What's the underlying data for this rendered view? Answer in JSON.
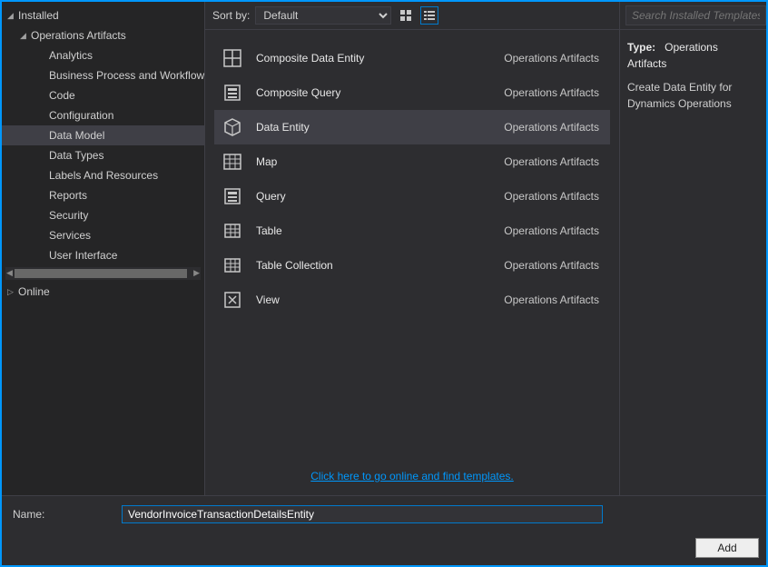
{
  "sidebar": {
    "root": "Installed",
    "group": "Operations Artifacts",
    "items": [
      "Analytics",
      "Business Process and Workflow",
      "Code",
      "Configuration",
      "Data Model",
      "Data Types",
      "Labels And Resources",
      "Reports",
      "Security",
      "Services",
      "User Interface"
    ],
    "selected_index": 4,
    "online": "Online"
  },
  "sortbar": {
    "label": "Sort by:",
    "value": "Default"
  },
  "templates": [
    {
      "name": "Composite Data Entity",
      "category": "Operations Artifacts",
      "icon": "composite-entity"
    },
    {
      "name": "Composite Query",
      "category": "Operations Artifacts",
      "icon": "composite-query"
    },
    {
      "name": "Data Entity",
      "category": "Operations Artifacts",
      "icon": "data-entity"
    },
    {
      "name": "Map",
      "category": "Operations Artifacts",
      "icon": "map"
    },
    {
      "name": "Query",
      "category": "Operations Artifacts",
      "icon": "query"
    },
    {
      "name": "Table",
      "category": "Operations Artifacts",
      "icon": "table"
    },
    {
      "name": "Table Collection",
      "category": "Operations Artifacts",
      "icon": "table-collection"
    },
    {
      "name": "View",
      "category": "Operations Artifacts",
      "icon": "view"
    }
  ],
  "templates_selected_index": 2,
  "online_link": "Click here to go online and find templates.",
  "search": {
    "placeholder": "Search Installed Templates (C"
  },
  "details": {
    "type_label": "Type:",
    "type_value": "Operations Artifacts",
    "description": "Create Data Entity for Dynamics Operations"
  },
  "name_field": {
    "label": "Name:",
    "value": "VendorInvoiceTransactionDetailsEntity"
  },
  "buttons": {
    "add": "Add"
  }
}
